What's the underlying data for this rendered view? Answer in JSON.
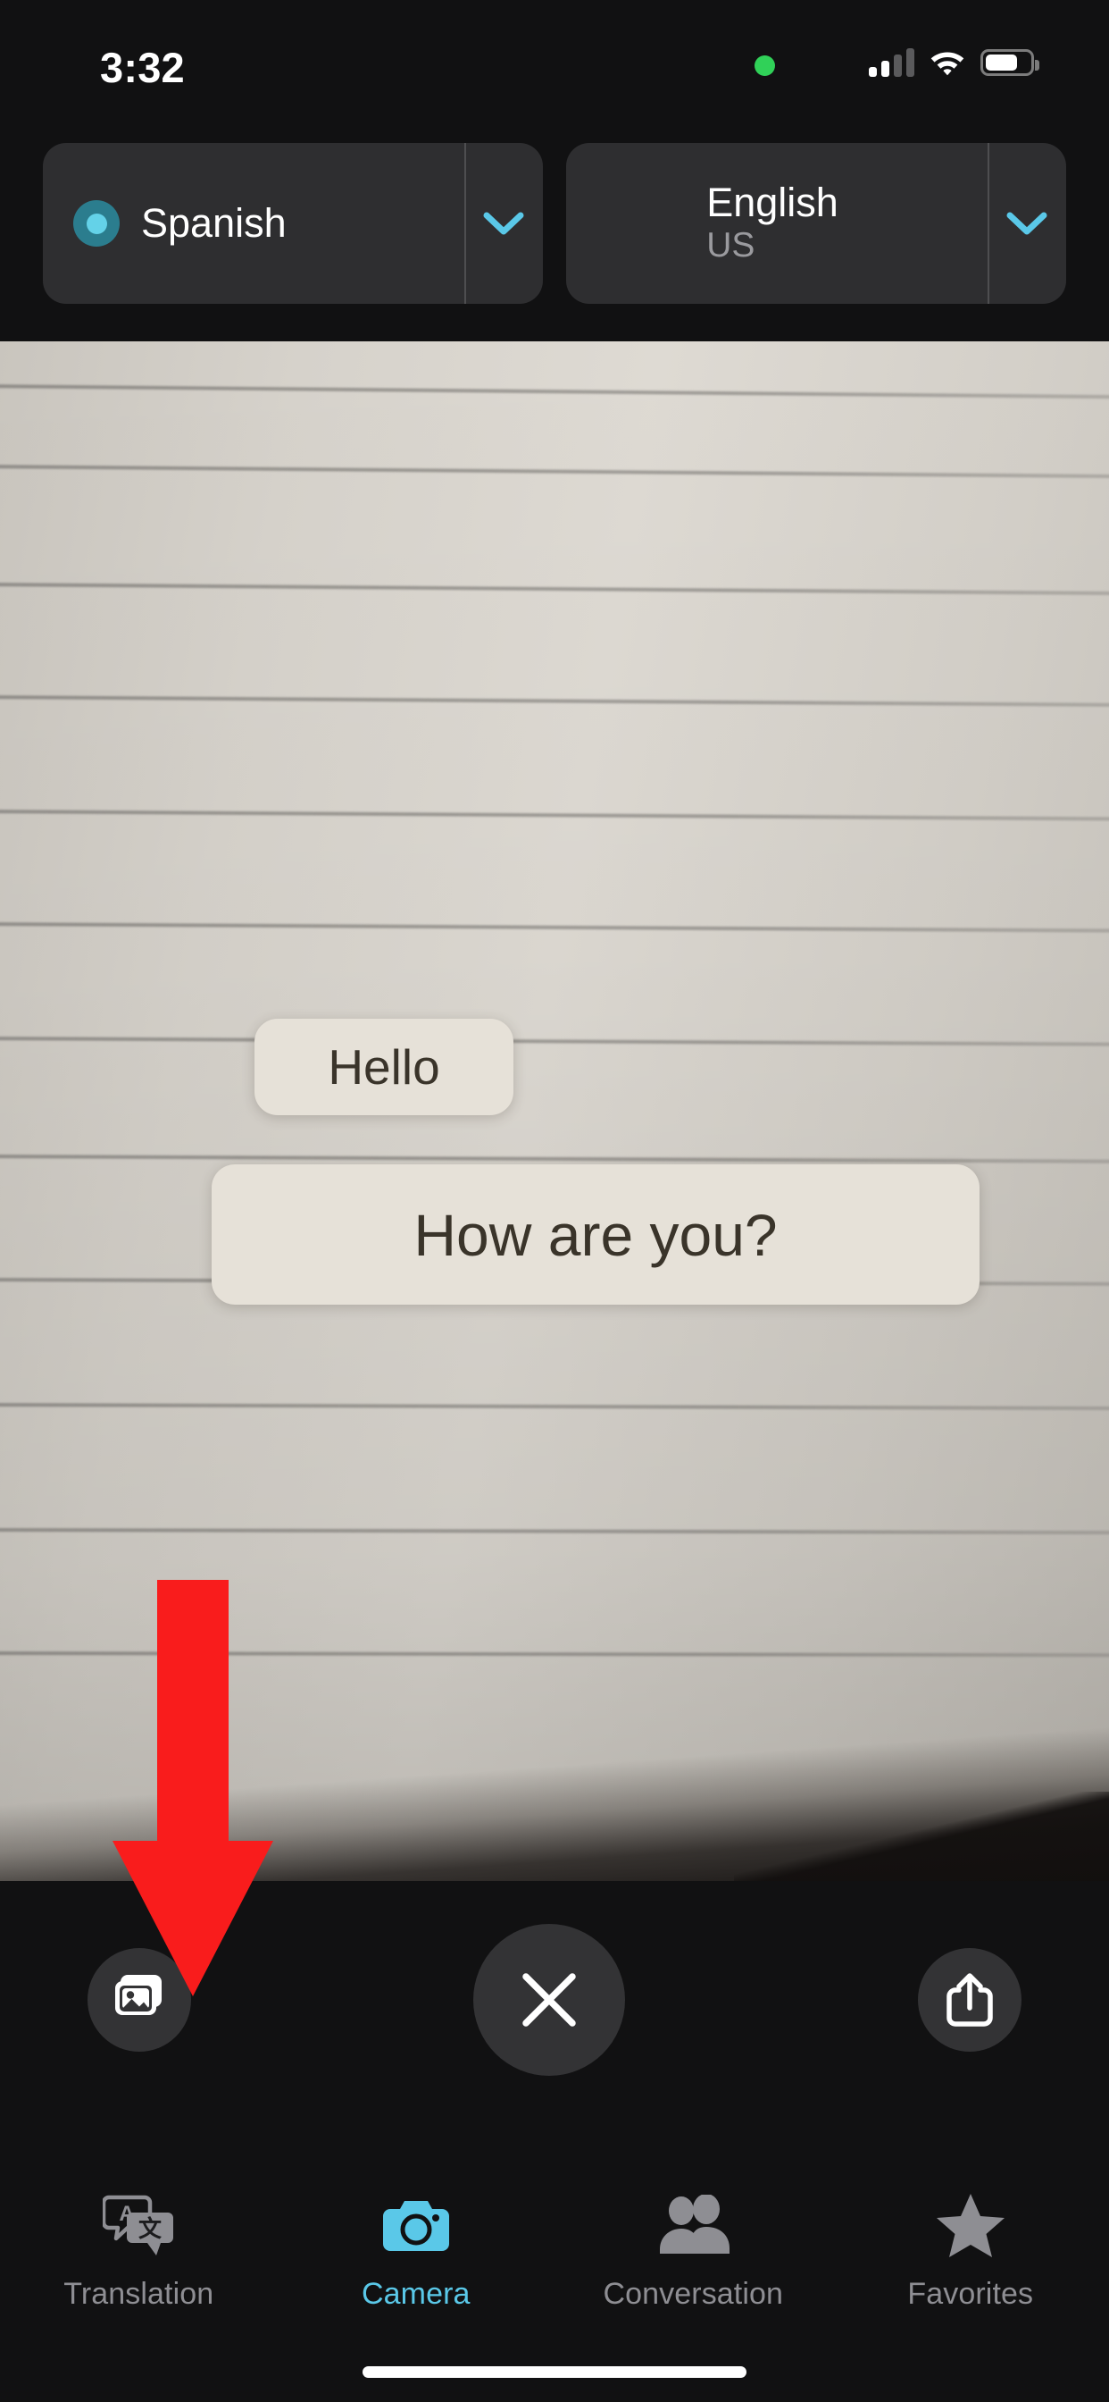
{
  "status_bar": {
    "time": "3:32",
    "green_dot_icon": "recording-indicator-dot",
    "cellular_icon": "cellular-signal-icon",
    "cellular_bars_filled": 2,
    "cellular_bars_total": 4,
    "wifi_icon": "wifi-icon",
    "battery_icon": "battery-icon",
    "battery_level_percent": 72
  },
  "language_bar": {
    "source": {
      "name": "Spanish",
      "sub": "",
      "radio_icon": "listening-radio-icon",
      "chevron_icon": "chevron-down-icon"
    },
    "target": {
      "name": "English",
      "sub": "US",
      "chevron_icon": "chevron-down-icon"
    }
  },
  "viewfinder": {
    "bubbles": [
      {
        "text": "Hello"
      },
      {
        "text": "How are you?"
      }
    ],
    "annotation": {
      "shape": "down-arrow",
      "color": "#f91c1c",
      "points_to": "photo-library-button"
    }
  },
  "controls": {
    "library_label": "Photo Library",
    "library_icon": "photo-library-icon",
    "close_label": "Close",
    "close_icon": "close-x-icon",
    "share_label": "Share",
    "share_icon": "share-icon"
  },
  "tab_bar": {
    "active": "Camera",
    "tabs": [
      {
        "label": "Translation",
        "icon": "translation-bubbles-icon",
        "active": false
      },
      {
        "label": "Camera",
        "icon": "camera-icon",
        "active": true
      },
      {
        "label": "Conversation",
        "icon": "people-icon",
        "active": false
      },
      {
        "label": "Favorites",
        "icon": "star-icon",
        "active": false
      }
    ]
  },
  "colors": {
    "accent": "#5ac8e8",
    "background": "#111112",
    "pill": "#2e2e30",
    "inactive_tab": "#8e8e93",
    "annotation_red": "#f91c1c",
    "bubble_bg": "#e6e1d8",
    "bubble_text": "#3a342a"
  }
}
